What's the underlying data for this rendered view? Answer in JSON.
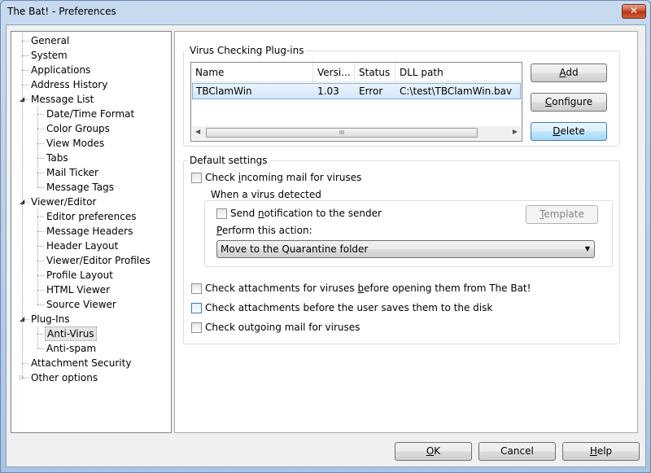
{
  "window": {
    "title": "The Bat! - Preferences",
    "close_glyph": "✕"
  },
  "tree": {
    "items": [
      {
        "label": "General",
        "level": 0
      },
      {
        "label": "System",
        "level": 0
      },
      {
        "label": "Applications",
        "level": 0
      },
      {
        "label": "Address History",
        "level": 0
      },
      {
        "label": "Message List",
        "level": 0,
        "expanded": true
      },
      {
        "label": "Date/Time Format",
        "level": 1
      },
      {
        "label": "Color Groups",
        "level": 1
      },
      {
        "label": "View Modes",
        "level": 1
      },
      {
        "label": "Tabs",
        "level": 1
      },
      {
        "label": "Mail Ticker",
        "level": 1
      },
      {
        "label": "Message Tags",
        "level": 1
      },
      {
        "label": "Viewer/Editor",
        "level": 0,
        "expanded": true
      },
      {
        "label": "Editor preferences",
        "level": 1
      },
      {
        "label": "Message Headers",
        "level": 1
      },
      {
        "label": "Header Layout",
        "level": 1
      },
      {
        "label": "Viewer/Editor Profiles",
        "level": 1
      },
      {
        "label": "Profile Layout",
        "level": 1
      },
      {
        "label": "HTML Viewer",
        "level": 1
      },
      {
        "label": "Source Viewer",
        "level": 1
      },
      {
        "label": "Plug-Ins",
        "level": 0,
        "expanded": true
      },
      {
        "label": "Anti-Virus",
        "level": 1,
        "selected": true
      },
      {
        "label": "Anti-spam",
        "level": 1
      },
      {
        "label": "Attachment Security",
        "level": 0
      },
      {
        "label": "Other options",
        "level": 0,
        "collapsed": true
      }
    ]
  },
  "plugins_group": {
    "title": "Virus Checking Plug-ins",
    "columns": [
      "Name",
      "Versi...",
      "Status",
      "DLL path"
    ],
    "rows": [
      {
        "name": "TBClamWin",
        "version": "1.03",
        "status": "Error",
        "path": "C:\\test\\TBClamWin.bav"
      }
    ],
    "scroll_grip": "III",
    "buttons": {
      "add": {
        "pre": "",
        "key": "A",
        "post": "dd"
      },
      "configure": {
        "pre": "",
        "key": "C",
        "post": "onfigure"
      },
      "delete": {
        "pre": "",
        "key": "D",
        "post": "elete"
      }
    }
  },
  "default_settings": {
    "title": "Default settings",
    "check_incoming": {
      "pre": "Check ",
      "key": "i",
      "post": "ncoming mail for viruses"
    },
    "virus_detected_group": {
      "title": "When a virus detected",
      "send_notification": {
        "pre": "Send ",
        "key": "n",
        "post": "otification to the sender"
      },
      "template_button": {
        "pre": "",
        "key": "T",
        "post": "emplate"
      },
      "perform_action_label": {
        "pre": "",
        "key": "P",
        "post": "erform this action:"
      },
      "action_value": "Move to the Quarantine folder"
    },
    "check_attachments_before_opening": {
      "pre": "Check attachments for viruses ",
      "key": "b",
      "post": "efore opening them from The Bat!"
    },
    "check_attachments_before_saving": "Check attachments before the user saves them to the disk",
    "check_outgoing": "Check outgoing mail for viruses"
  },
  "footer": {
    "ok": {
      "pre": "",
      "key": "O",
      "post": "K"
    },
    "cancel": "Cancel",
    "help": {
      "pre": "",
      "key": "H",
      "post": "elp"
    }
  }
}
